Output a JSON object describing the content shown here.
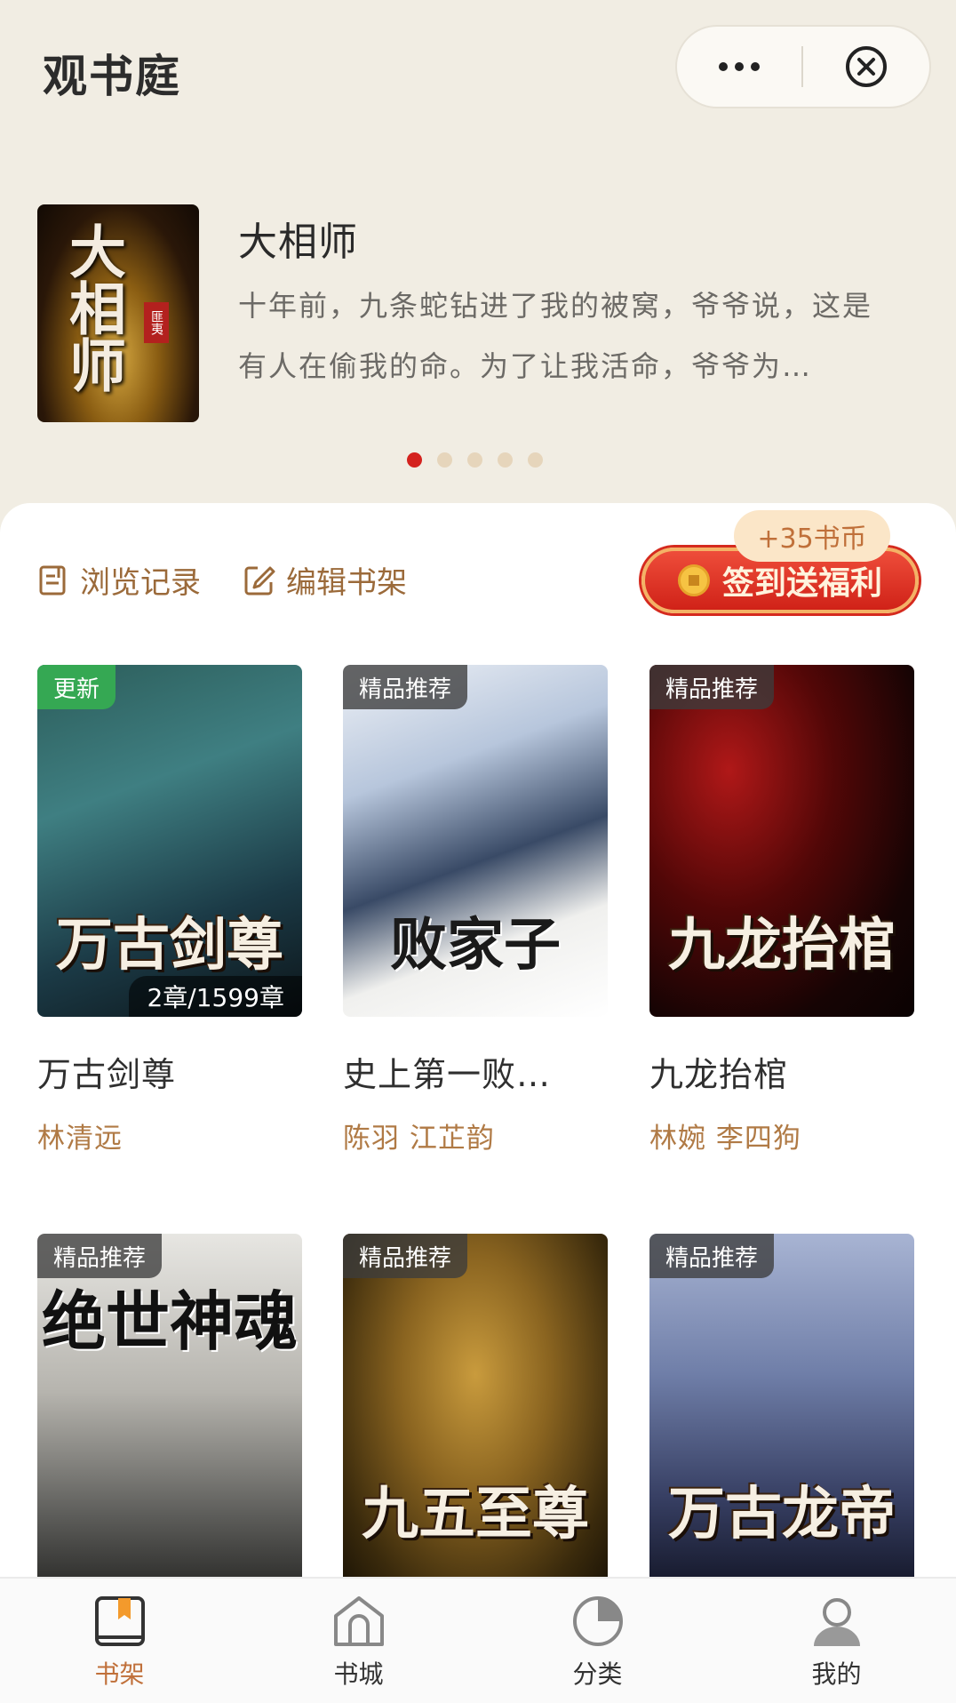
{
  "app": {
    "title": "观书庭"
  },
  "featured": {
    "title": "大相师",
    "description": "十年前，九条蛇钻进了我的被窝，爷爷说，这是有人在偷我的命。为了让我活命，爷爷为…",
    "cover_title": "大相师",
    "cover_seal": "匪夷",
    "carousel_total": 5,
    "carousel_active": 1
  },
  "actions": {
    "history_label": "浏览记录",
    "edit_label": "编辑书架",
    "checkin_label": "签到送福利",
    "checkin_reward": "+35书币"
  },
  "books": [
    {
      "badge": "更新",
      "badge_type": "update",
      "cover_title": "万古剑尊",
      "chapters": "2章/1599章",
      "name": "万古剑尊",
      "author": "林清远"
    },
    {
      "badge": "精品推荐",
      "badge_type": "featured",
      "cover_title": "败家子",
      "name": "史上第一败…",
      "author": "陈羽 江芷韵"
    },
    {
      "badge": "精品推荐",
      "badge_type": "featured",
      "cover_title": "九龙抬棺",
      "name": "九龙抬棺",
      "author": "林婉 李四狗"
    },
    {
      "badge": "精品推荐",
      "badge_type": "featured",
      "cover_title": "绝世神魂",
      "name": "",
      "author": ""
    },
    {
      "badge": "精品推荐",
      "badge_type": "featured",
      "cover_title": "九五至尊",
      "name": "",
      "author": ""
    },
    {
      "badge": "精品推荐",
      "badge_type": "featured",
      "cover_title": "万古龙帝",
      "name": "",
      "author": ""
    }
  ],
  "tabbar": [
    {
      "label": "书架",
      "icon": "bookshelf-icon",
      "active": true
    },
    {
      "label": "书城",
      "icon": "bookstore-icon",
      "active": false
    },
    {
      "label": "分类",
      "icon": "category-icon",
      "active": false
    },
    {
      "label": "我的",
      "icon": "profile-icon",
      "active": false
    }
  ],
  "colors": {
    "accent": "#c0703a",
    "carousel_active": "#d4221e",
    "checkin_red": "#d02218",
    "update_badge": "#35a853"
  }
}
